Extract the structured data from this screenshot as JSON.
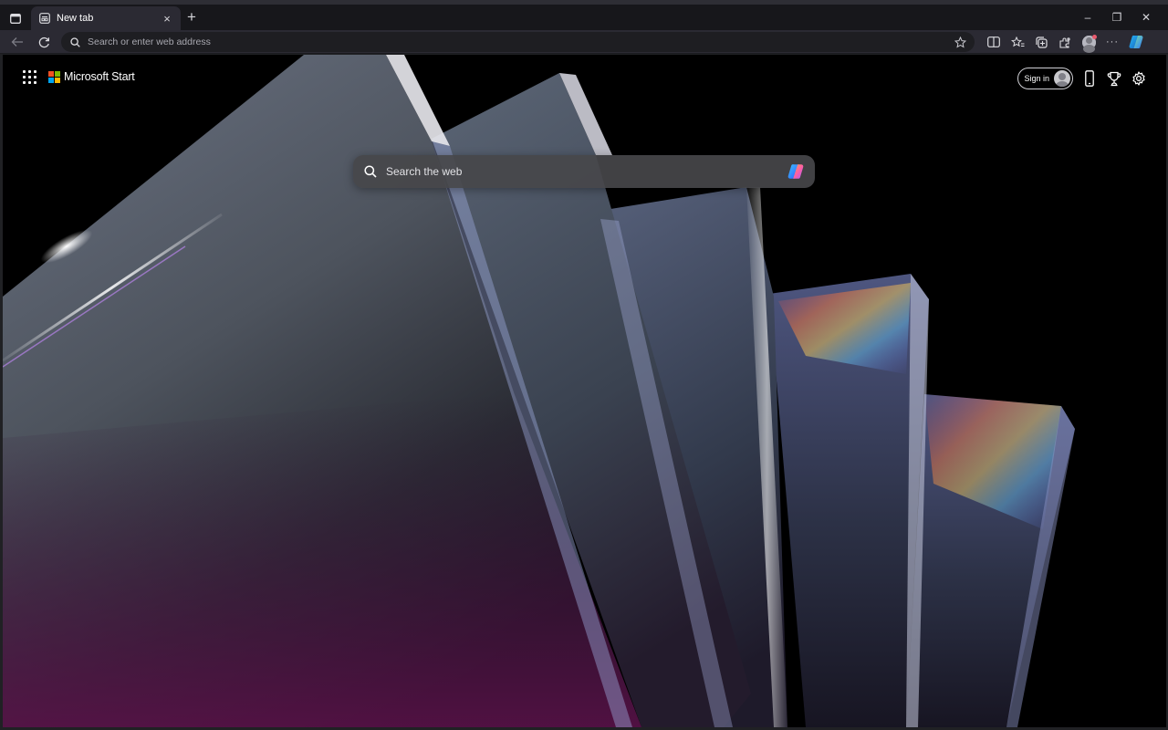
{
  "browser": {
    "tab": {
      "title": "New tab"
    },
    "new_tab_symbol": "+",
    "close_tab_symbol": "×",
    "window_controls": {
      "minimize": "–",
      "restore": "❐",
      "close": "✕"
    },
    "address_bar": {
      "placeholder": "Search or enter web address",
      "value": ""
    },
    "toolbar_icons": [
      "split-screen-icon",
      "favorites-icon",
      "collections-icon",
      "extensions-icon",
      "profile-icon",
      "more-icon",
      "copilot-icon"
    ],
    "more_label": "···"
  },
  "page": {
    "brand": {
      "name": "Microsoft Start"
    },
    "search": {
      "placeholder": "Search the web",
      "value": ""
    },
    "header": {
      "sign_in_label": "Sign in"
    }
  },
  "colors": {
    "ms_red": "#f25022",
    "ms_green": "#7fba00",
    "ms_blue": "#00a4ef",
    "ms_yellow": "#ffb900"
  }
}
